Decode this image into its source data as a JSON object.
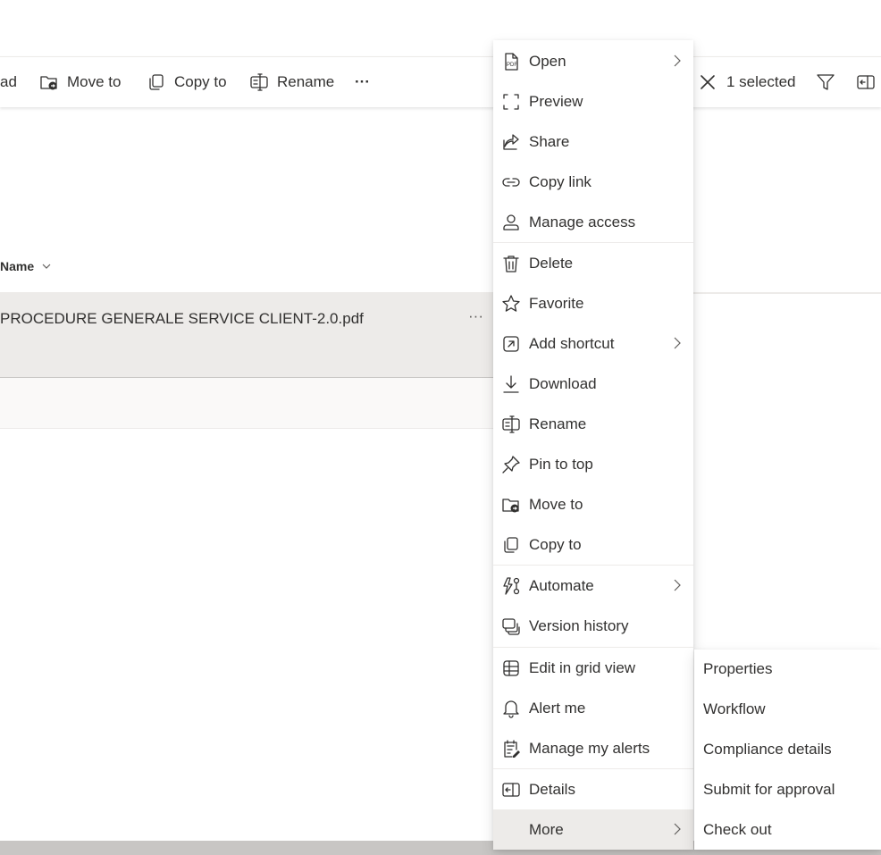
{
  "toolbar": {
    "download_label": "ad",
    "move_to_label": "Move to",
    "copy_to_label": "Copy to",
    "rename_label": "Rename",
    "more_label": "···",
    "selection_label": "1 selected"
  },
  "list": {
    "name_header": "Name",
    "rows": [
      {
        "name": "PROCEDURE GENERALE SERVICE CLIENT-2.0.pdf",
        "more": "···"
      }
    ]
  },
  "context_menu": {
    "items": [
      {
        "label": "Open",
        "icon": "pdf-file-icon",
        "submenu": true
      },
      {
        "label": "Preview",
        "icon": "preview-icon"
      },
      {
        "label": "Share",
        "icon": "share-icon"
      },
      {
        "label": "Copy link",
        "icon": "link-icon"
      },
      {
        "label": "Manage access",
        "icon": "person-icon"
      },
      {
        "label": "Delete",
        "icon": "trash-icon"
      },
      {
        "label": "Favorite",
        "icon": "star-icon"
      },
      {
        "label": "Add shortcut",
        "icon": "shortcut-icon",
        "submenu": true
      },
      {
        "label": "Download",
        "icon": "download-icon"
      },
      {
        "label": "Rename",
        "icon": "rename-icon"
      },
      {
        "label": "Pin to top",
        "icon": "pin-icon"
      },
      {
        "label": "Move to",
        "icon": "move-folder-icon"
      },
      {
        "label": "Copy to",
        "icon": "copy-icon"
      },
      {
        "label": "Automate",
        "icon": "automate-icon",
        "submenu": true
      },
      {
        "label": "Version history",
        "icon": "version-history-icon"
      },
      {
        "label": "Edit in grid view",
        "icon": "grid-icon"
      },
      {
        "label": "Alert me",
        "icon": "bell-icon"
      },
      {
        "label": "Manage my alerts",
        "icon": "alerts-list-icon"
      },
      {
        "label": "Details",
        "icon": "details-icon"
      },
      {
        "label": "More",
        "icon": "",
        "submenu": true
      }
    ]
  },
  "more_submenu": {
    "items": [
      "Properties",
      "Workflow",
      "Compliance details",
      "Submit for approval",
      "Check out"
    ]
  }
}
